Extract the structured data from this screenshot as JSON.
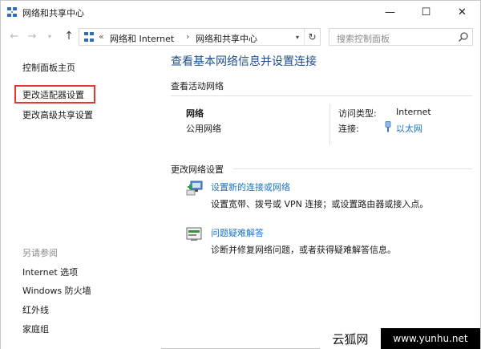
{
  "window": {
    "title": "网络和共享中心",
    "minimize_glyph": "—",
    "maximize_glyph": "☐",
    "close_glyph": "✕"
  },
  "nav": {
    "back_glyph": "←",
    "forward_glyph": "→",
    "history_glyph": "▾",
    "up_glyph": "↑"
  },
  "address": {
    "chevron": "«",
    "crumbs": [
      "网络和 Internet",
      "网络和共享中心"
    ],
    "separator": "›",
    "dropdown_glyph": "▾",
    "refresh_glyph": "↻"
  },
  "search": {
    "placeholder": "搜索控制面板",
    "icon": "search-icon"
  },
  "sidebar": {
    "home": "控制面板主页",
    "links": [
      "更改适配器设置",
      "更改高级共享设置"
    ],
    "highlighted_index": 0,
    "highlight_color": "#e03a2e",
    "see_also_title": "另请参阅",
    "see_also": [
      "Internet 选项",
      "Windows 防火墙",
      "红外线",
      "家庭组"
    ]
  },
  "main": {
    "title": "查看基本网络信息并设置连接",
    "active_networks_heading": "查看活动网络",
    "network": {
      "name": "网络",
      "type": "公用网络",
      "access_type_label": "访问类型:",
      "access_type_value": "Internet",
      "connections_label": "连接:",
      "connections_value": "以太网"
    },
    "change_settings_heading": "更改网络设置",
    "tasks": [
      {
        "link": "设置新的连接或网络",
        "desc": "设置宽带、拨号或 VPN 连接；或设置路由器或接入点。",
        "icon": "new-connection-icon"
      },
      {
        "link": "问题疑难解答",
        "desc": "诊断并修复网络问题，或者获得疑难解答信息。",
        "icon": "troubleshoot-icon"
      }
    ]
  },
  "watermark": {
    "text_cn": "云狐网",
    "url": "www.yunhu.net"
  },
  "colors": {
    "link": "#1a73c8",
    "title_blue": "#1e4e8c",
    "highlight_red": "#e03a2e"
  }
}
